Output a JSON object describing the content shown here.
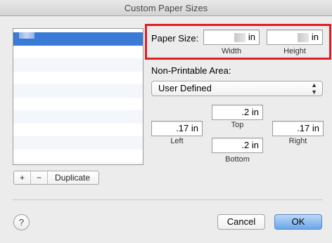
{
  "window": {
    "title": "Custom Paper Sizes"
  },
  "list": {
    "rows": 10
  },
  "list_buttons": {
    "add": "+",
    "remove": "−",
    "duplicate": "Duplicate"
  },
  "paper_size": {
    "label": "Paper Size:",
    "width": {
      "unit": "in",
      "caption": "Width"
    },
    "height": {
      "unit": "in",
      "caption": "Height"
    }
  },
  "non_printable": {
    "label": "Non-Printable Area:",
    "selected": "User Defined",
    "top": {
      "value": ".2 in",
      "caption": "Top"
    },
    "left": {
      "value": ".17 in",
      "caption": "Left"
    },
    "right": {
      "value": ".17 in",
      "caption": "Right"
    },
    "bottom": {
      "value": ".2 in",
      "caption": "Bottom"
    }
  },
  "footer": {
    "help": "?",
    "cancel": "Cancel",
    "ok": "OK"
  },
  "colors": {
    "highlight": "#e01e25",
    "selection": "#3a7bd5",
    "default_button": "#6aa6ea"
  }
}
